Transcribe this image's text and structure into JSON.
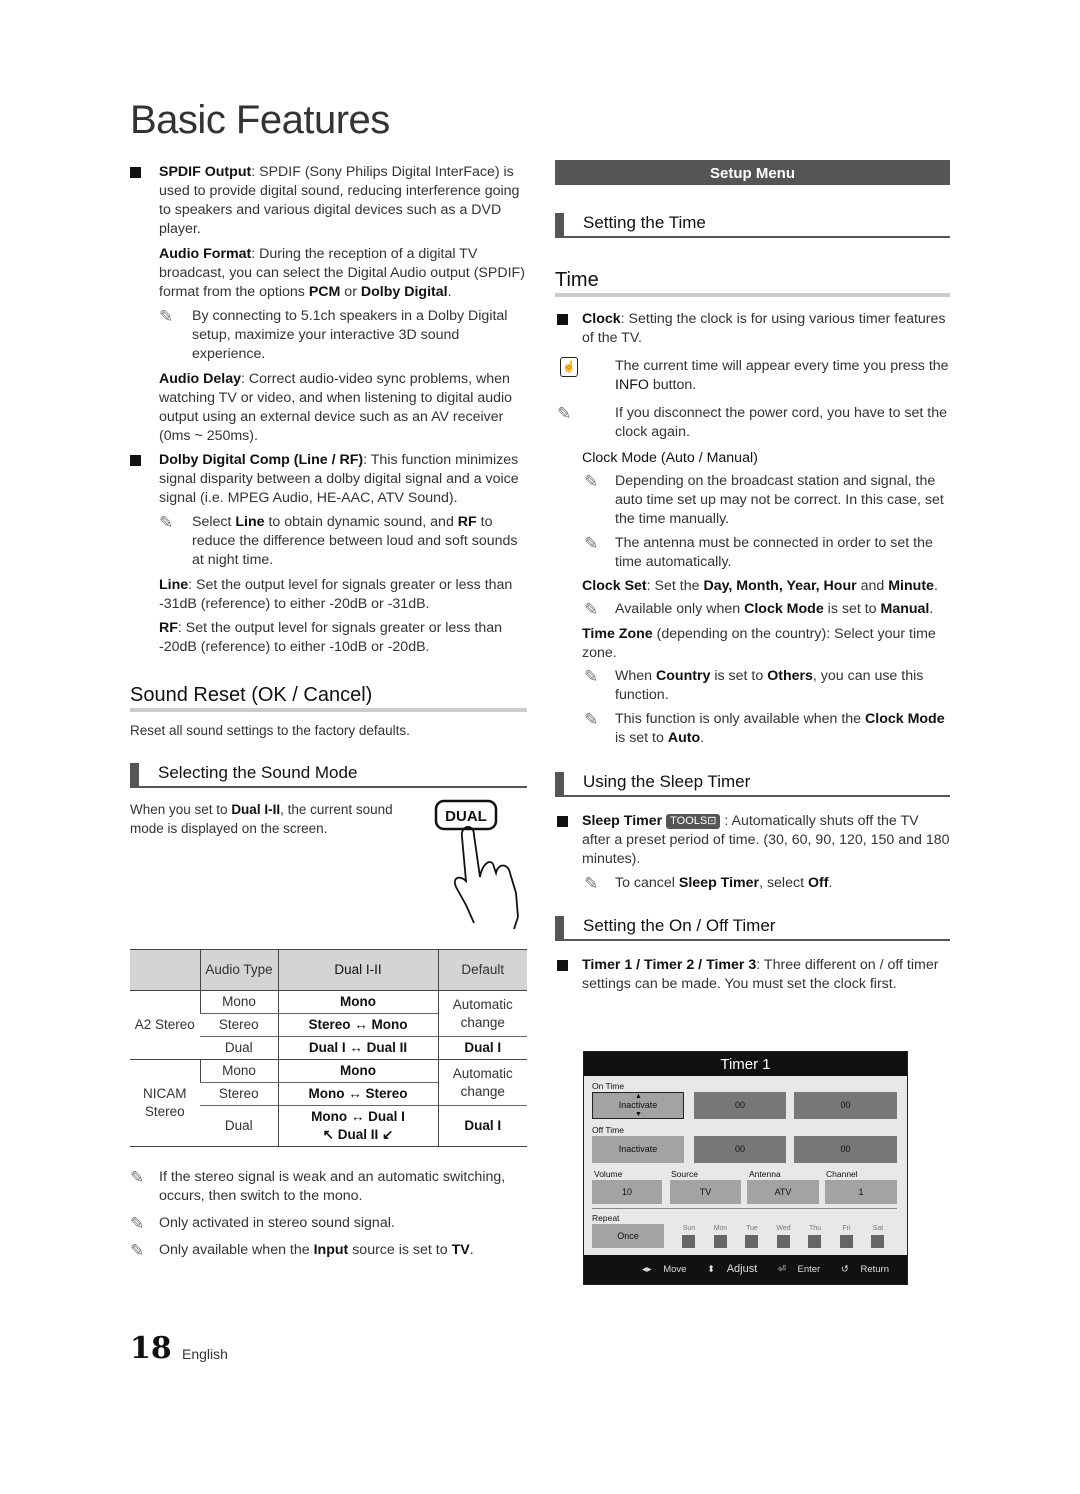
{
  "page": {
    "title": "Basic Features",
    "page_number": "18",
    "language": "English"
  },
  "left": {
    "spdif": {
      "label": "SPDIF Output",
      "text": ": SPDIF (Sony Philips Digital InterFace) is used to provide digital sound, reducing interference going to speakers and various digital devices such as a DVD player."
    },
    "audio_format": {
      "label": "Audio Format",
      "text_1": ": During the reception of a digital TV broadcast, you can select the Digital Audio output (SPDIF) format from the options ",
      "opt1": "PCM",
      "or": " or ",
      "opt2": "Dolby Digital",
      "end": ".",
      "note": "By connecting to 5.1ch speakers in a Dolby Digital setup, maximize your interactive 3D sound experience."
    },
    "audio_delay": {
      "label": "Audio Delay",
      "text": ": Correct audio-video sync problems, when watching TV or video, and when listening to digital audio output using an external device such as an AV receiver (0ms ~ 250ms)."
    },
    "dolby_comp": {
      "label": "Dolby Digital Comp (Line / RF)",
      "text": ": This function minimizes signal disparity between a dolby digital signal and a voice signal (i.e. MPEG Audio, HE-AAC, ATV Sound).",
      "note_1": "Select ",
      "note_line": "Line",
      "note_2": " to obtain dynamic sound, and ",
      "note_rf": "RF",
      "note_3": " to reduce the difference between loud and soft sounds at night time."
    },
    "line": {
      "label": "Line",
      "text": ": Set the output level for signals greater or less than -31dB (reference) to either -20dB or -31dB."
    },
    "rf": {
      "label": "RF",
      "text": ": Set the output level for signals greater or less than -20dB (reference) to either -10dB or -20dB."
    },
    "sound_reset": {
      "heading": "Sound Reset (OK / Cancel)",
      "text": "Reset all sound settings to the factory defaults."
    },
    "sound_mode": {
      "heading": "Selecting the Sound Mode",
      "text_1": "When you set to ",
      "bold": "Dual I-II",
      "text_2": ", the current sound mode is displayed on the screen.",
      "button_label": "DUAL"
    },
    "table": {
      "headers": [
        "",
        "Audio Type",
        "Dual I-II",
        "Default"
      ],
      "groups": [
        {
          "name": "A2 Stereo",
          "rows": [
            {
              "type": "Mono",
              "dual": "Mono"
            },
            {
              "type": "Stereo",
              "dual": "Stereo ↔ Mono"
            },
            {
              "type": "Dual",
              "dual": "Dual I ↔ Dual II"
            }
          ],
          "default_auto": "Automatic change",
          "default_dual": "Dual I"
        },
        {
          "name": "NICAM Stereo",
          "rows": [
            {
              "type": "Mono",
              "dual": "Mono"
            },
            {
              "type": "Stereo",
              "dual": "Mono ↔ Stereo"
            },
            {
              "type": "Dual",
              "dual_1": "Mono ↔ Dual I",
              "dual_2": "↖ Dual II ↙"
            }
          ],
          "default_auto": "Automatic change",
          "default_dual": "Dual I"
        }
      ]
    },
    "notes": {
      "n1": "If the stereo signal is weak and an automatic switching, occurs, then switch to the mono.",
      "n2": "Only activated in stereo sound signal.",
      "n3_1": "Only available when the ",
      "n3_input": "Input",
      "n3_2": " source is set to ",
      "n3_tv": "TV",
      "n3_3": "."
    }
  },
  "right": {
    "setup_menu": "Setup Menu",
    "setting_time": "Setting the Time",
    "time_heading": "Time",
    "clock": {
      "label": "Clock",
      "text": ": Setting the clock is for using various timer features of the TV.",
      "info_1": "The current time will appear every time you press the ",
      "info_bold": "INFO",
      "info_2": " button.",
      "note": "If you disconnect the power cord, you have to set the clock again."
    },
    "clock_mode": {
      "label": "Clock Mode (Auto / Manual)",
      "note_1": "Depending on the broadcast station and signal, the auto time set up may not be correct. In this case, set the time manually.",
      "note_2": "The antenna must be connected in order to set the time automatically."
    },
    "clock_set": {
      "label": "Clock Set",
      "text_1": ": Set the ",
      "bold_1": "Day, Month, Year, Hour",
      "text_2": " and ",
      "bold_2": "Minute",
      "text_3": ".",
      "note_1": "Available only when ",
      "note_bold": "Clock Mode",
      "note_2": " is set to ",
      "note_manual": "Manual",
      "note_3": "."
    },
    "time_zone": {
      "label": "Time Zone",
      "text": " (depending on the country): Select your time zone.",
      "note1_1": "When ",
      "note1_country": "Country",
      "note1_2": " is set to ",
      "note1_others": "Others",
      "note1_3": ", you can use this function.",
      "note2_1": "This function is only available when the ",
      "note2_mode": "Clock Mode",
      "note2_2": " is set to ",
      "note2_auto": "Auto",
      "note2_3": "."
    },
    "sleep": {
      "heading": "Using the Sleep Timer",
      "label": "Sleep Timer",
      "badge": "TOOLS⊡",
      "text": " : Automatically shuts off the TV after a preset period of time. (30, 60, 90, 120, 150 and 180 minutes).",
      "note_1": "To cancel ",
      "note_bold": "Sleep Timer",
      "note_2": ", select ",
      "note_off": "Off",
      "note_3": "."
    },
    "onoff": {
      "heading": "Setting the On / Off Timer",
      "label": "Timer 1 / Timer 2 / Timer 3",
      "text": ": Three different on / off timer settings can be made. You must set the clock first."
    },
    "osd": {
      "title": "Timer 1",
      "on_time_label": "On Time",
      "on_time": {
        "state": "Inactivate",
        "hour": "00",
        "minute": "00"
      },
      "off_time_label": "Off Time",
      "off_time": {
        "state": "Inactivate",
        "hour": "00",
        "minute": "00"
      },
      "volume_label": "Volume",
      "volume": "10",
      "source_label": "Source",
      "source": "TV",
      "antenna_label": "Antenna",
      "antenna": "ATV",
      "channel_label": "Channel",
      "channel": "1",
      "repeat_label": "Repeat",
      "repeat": "Once",
      "days": [
        "Sun",
        "Mon",
        "Tue",
        "Wed",
        "Thu",
        "Fri",
        "Sat"
      ],
      "footer": {
        "move": "Move",
        "adjust": "Adjust",
        "enter": "Enter",
        "return": "Return"
      }
    }
  }
}
